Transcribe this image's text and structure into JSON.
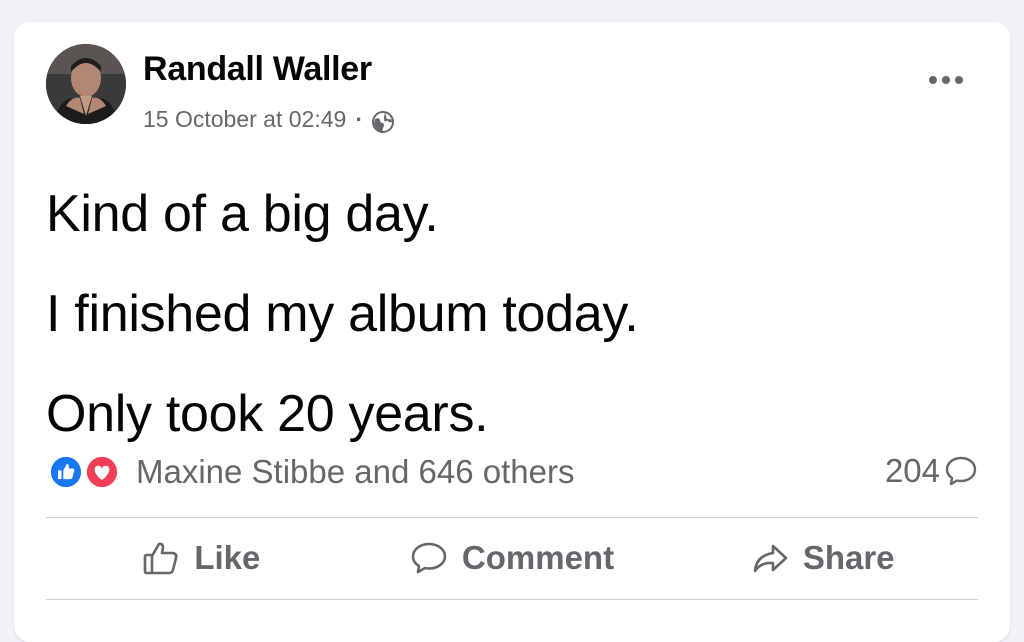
{
  "post": {
    "author": {
      "name": "Randall Waller",
      "avatar_icon": "profile-photo"
    },
    "timestamp": "15 October at 02:49",
    "separator": "·",
    "audience_icon": "globe-icon",
    "lines": [
      "Kind of a big day.",
      "I finished my album today.",
      "Only took 20 years."
    ]
  },
  "engagement": {
    "reaction_icons": [
      "like-icon",
      "love-icon"
    ],
    "reactions_text": "Maxine Stibbe and 646 others",
    "comments_count": "204",
    "comment_icon": "speech-bubble-icon"
  },
  "actions": {
    "like_label": "Like",
    "comment_label": "Comment",
    "share_label": "Share"
  },
  "colors": {
    "like_blue": "#1877f2",
    "love_red": "#f33e58",
    "secondary_text": "#65676b",
    "primary_text": "#050505",
    "background": "#f0f2f5"
  }
}
